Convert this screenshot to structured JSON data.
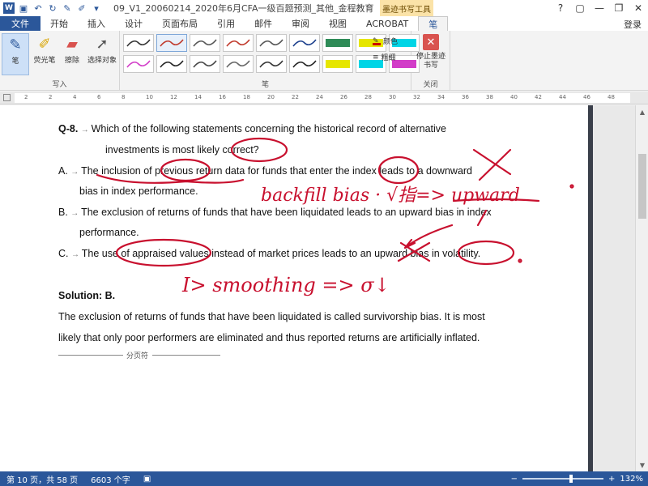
{
  "titlebar": {
    "doc_title": "09_V1_20060214_2020年6月CFA一级百题预测_其他_金程教育（授...",
    "context_tab": "墨迹书写工具",
    "help": "?",
    "min": "—",
    "restore": "❐",
    "close": "✕"
  },
  "tabs": [
    "文件",
    "开始",
    "插入",
    "设计",
    "页面布局",
    "引用",
    "邮件",
    "审阅",
    "视图",
    "ACROBAT",
    "笔"
  ],
  "login": "登录",
  "ribbon": {
    "write_group": "写入",
    "pen_group": "笔",
    "close_group": "关闭",
    "pen_btn": "笔",
    "highlighter_btn": "荧光笔",
    "eraser_btn": "擦除",
    "select_btn": "选择对象",
    "color_label": "颜色",
    "thickness_label": "粗细",
    "stop_label": "停止墨迹书写",
    "pen_colors": [
      "#333333",
      "#c0392b",
      "#555555",
      "#c0392b",
      "#555555",
      "#1a3e8c",
      "#2e8b57",
      "#e6e600",
      "#00d5e6",
      "#d23cc8",
      "#222222",
      "#444444",
      "#666666",
      "#333333",
      "#222222",
      "#e6e600",
      "#00d5e6",
      "#d23cc8"
    ]
  },
  "ruler": {
    "numbers": [
      "2",
      "2",
      "4",
      "6",
      "8",
      "10",
      "12",
      "14",
      "16",
      "18",
      "20",
      "22",
      "24",
      "26",
      "28",
      "30",
      "32",
      "34",
      "36",
      "38",
      "40",
      "42",
      "44",
      "46",
      "48"
    ]
  },
  "doc": {
    "q_label": "Q-8.",
    "q_line1": "Which of the following statements concerning the historical record of alternative",
    "q_line2": "investments is most likely correct?",
    "a_label": "A.",
    "a_line1": "The inclusion of previous return data for funds that enter the index leads to a downward",
    "a_line2": "bias in index performance.",
    "b_label": "B.",
    "b_line1": "The exclusion of returns of funds that have been liquidated leads to an upward bias in index",
    "b_line2": "performance.",
    "c_label": "C.",
    "c_line1": "The use of appraised values instead of market prices leads to an upward bias in volatility.",
    "solution": "Solution: B.",
    "sol_line1": "The exclusion of returns of funds that have been liquidated is called survivorship bias. It is most",
    "sol_line2": "likely that only poor performers are eliminated and thus reported returns are artificially inflated.",
    "page_break": "分页符",
    "ink_backfill": "backfill bias · √指=> upward",
    "ink_smoothing": "I> smoothing => σ↓"
  },
  "status": {
    "page": "第 10 页，共 58 页",
    "words": "6603 个字",
    "zoom": "132%"
  }
}
